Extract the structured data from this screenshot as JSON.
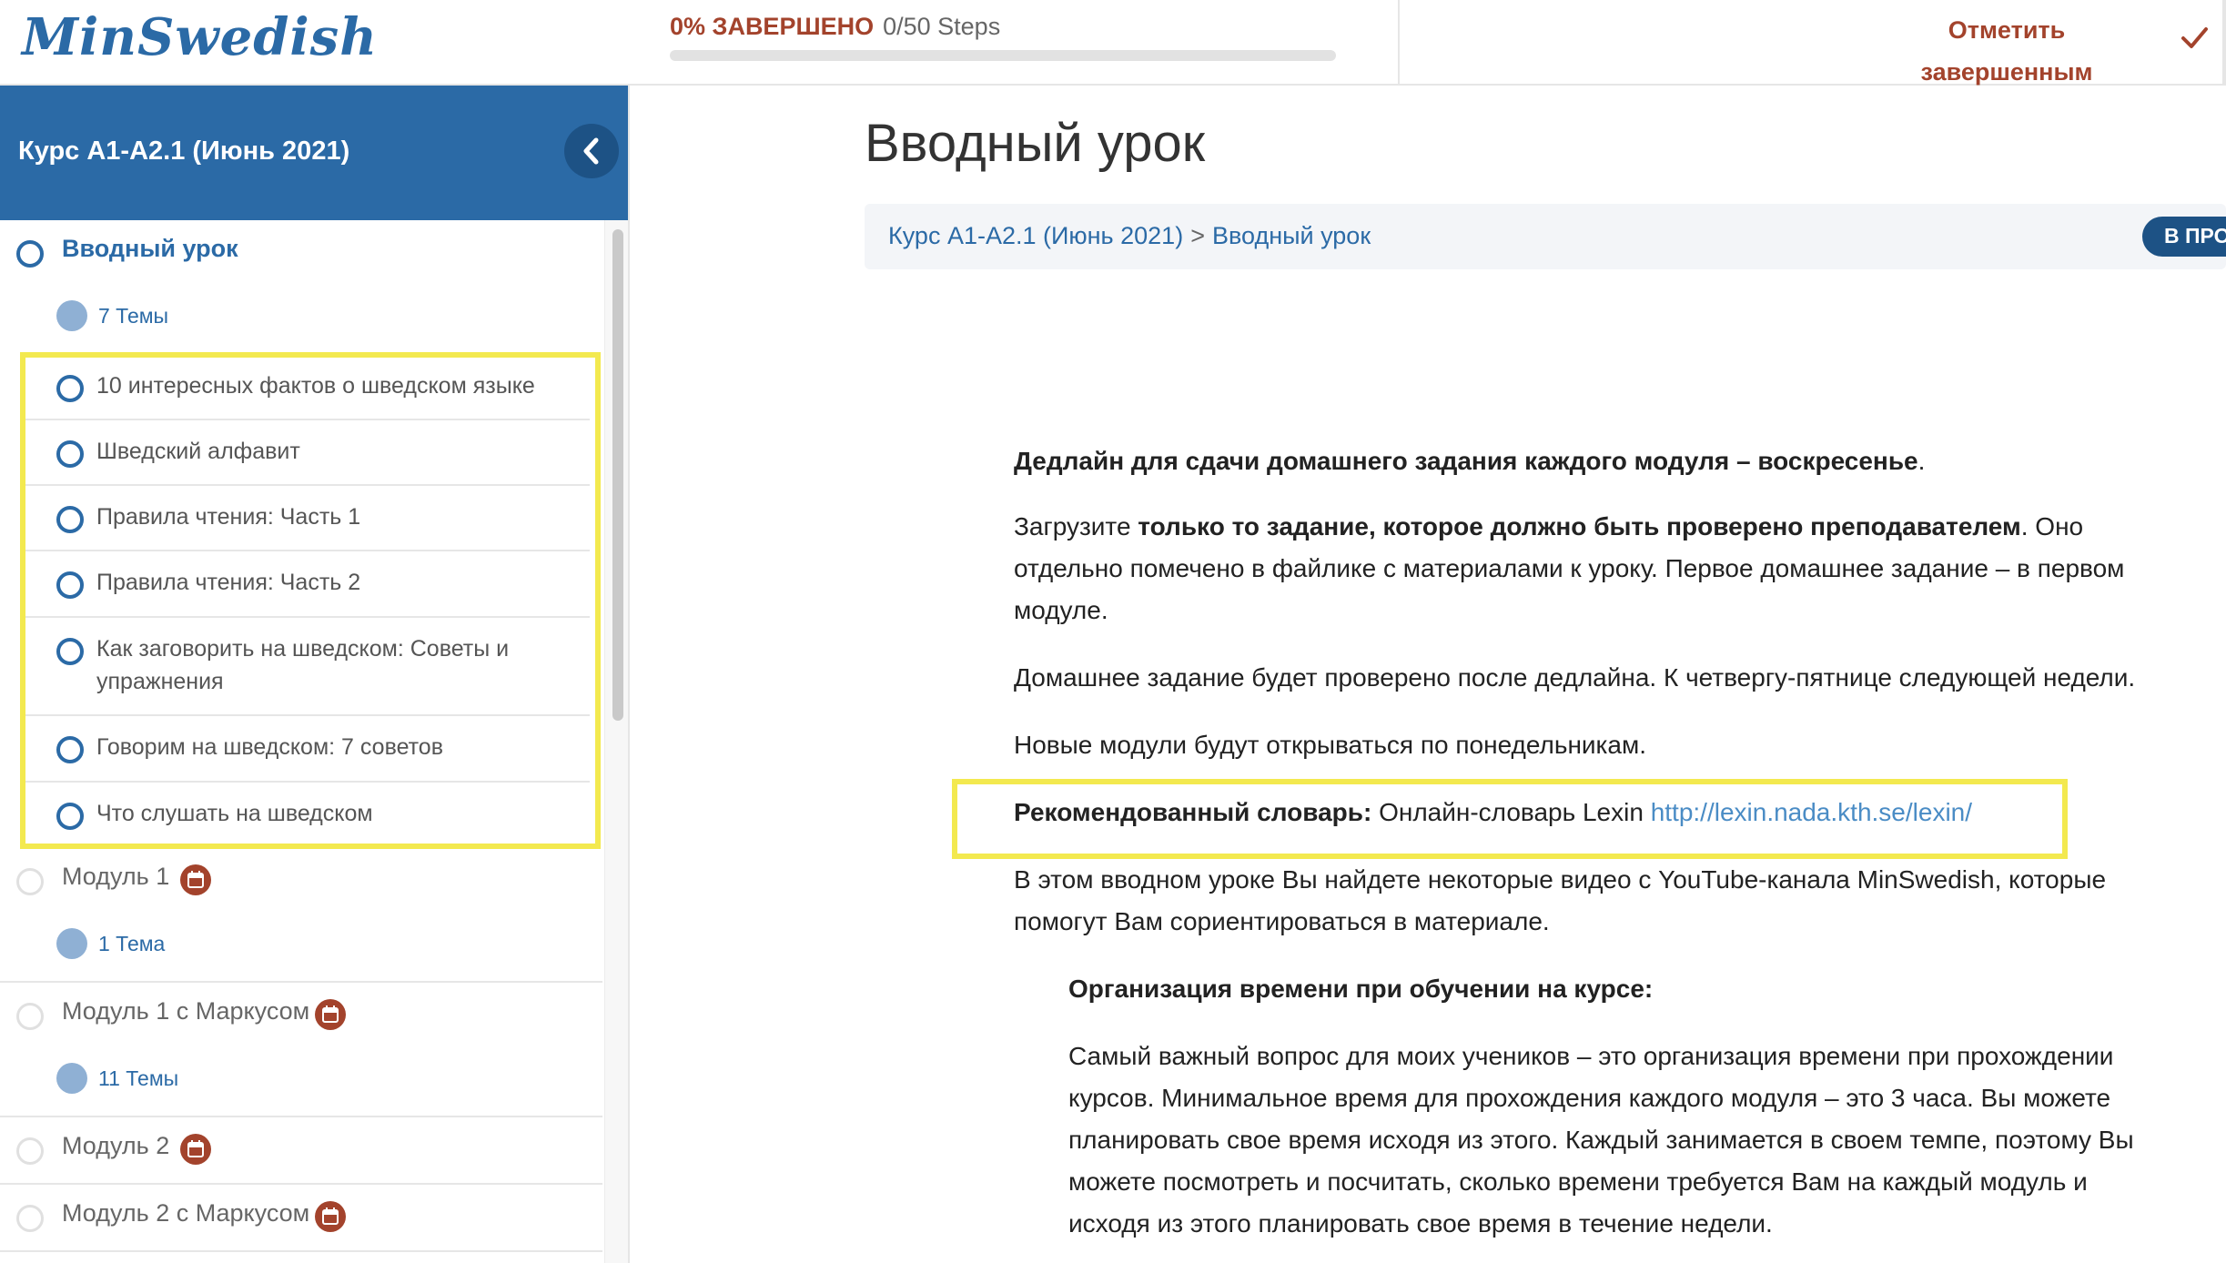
{
  "header": {
    "logo": "MinSwedish",
    "progress_percent_label": "0% ЗАВЕРШЕНО",
    "progress_steps": "0/50 Steps",
    "progress_fraction": 0,
    "mark_complete_line1": "Отметить",
    "mark_complete_line2": "завершенным"
  },
  "sidebar": {
    "course_title": "Курс A1-A2.1 (Июнь 2021)",
    "lessons": [
      {
        "label": "Вводный урок",
        "topics": "7 Темы",
        "active": true
      },
      {
        "label": "Модуль 1",
        "topics": "1 Тема",
        "active": false
      },
      {
        "label": "Модуль 1 с Маркусом",
        "topics": "11 Темы",
        "active": false
      },
      {
        "label": "Модуль 2",
        "topics": "",
        "active": false
      },
      {
        "label": "Модуль 2 с Маркусом",
        "topics": "",
        "active": false
      }
    ],
    "topics": [
      "10 интересных фактов о шведском языке",
      "Шведский алфавит",
      "Правила чтения: Часть 1",
      "Правила чтения: Часть 2",
      "Как заговорить на шведском: Советы и упражнения",
      "Говорим на шведском: 7 советов",
      "Что слушать на шведском"
    ]
  },
  "main": {
    "title": "Вводный урок",
    "breadcrumb": {
      "course": "Курс A1-A2.1 (Июнь 2021)",
      "separator": ">",
      "current": "Вводный урок"
    },
    "status_pill": "В ПРОЦЕССЕ",
    "content": {
      "p1_bold": "Дедлайн для сдачи домашнего задания каждого модуля – воскресенье",
      "p1_end": ".",
      "p2_start": "Загрузите ",
      "p2_bold": "только то задание, которое должно быть проверено преподавателем",
      "p2_end_line1": ". Оно",
      "p2_line2": "отдельно помечено в файлике с материалами к уроку. Первое домашнее задание – в первом",
      "p2_line3": "модуле.",
      "p3": "Домашнее задание будет проверено после дедлайна. К четвергу-пятнице следующей недели.",
      "p4": "Новые модули будут открываться по понедельникам.",
      "p5_bold": "Рекомендованный словарь:",
      "p5_text": " Онлайн-словарь Lexin ",
      "p5_link": "http://lexin.nada.kth.se/lexin/",
      "p6_line1": "В этом вводном уроке Вы найдете некоторые видео с YouTube-канала MinSwedish, которые",
      "p6_line2": "помогут Вам сориентироваться в материале.",
      "h_time": "Организация времени при обучении на курсе:",
      "p7_line1": "Самый важный вопрос для моих учеников – это организация времени при прохождении",
      "p7_line2": "курсов. Минимальное время для прохождения каждого модуля – это 3 часа. Вы можете",
      "p7_line3": "планировать свое время исходя из этого. Каждый занимается в своем темпе, поэтому Вы",
      "p7_line4": "можете посмотреть и посчитать, сколько времени требуется Вам на каждый модуль и",
      "p7_line5": "исходя из этого планировать свое время в течение недели."
    }
  },
  "colors": {
    "brand_blue": "#2b6aa6",
    "accent_red": "#a3432c",
    "highlight_yellow": "#f3e94f"
  }
}
